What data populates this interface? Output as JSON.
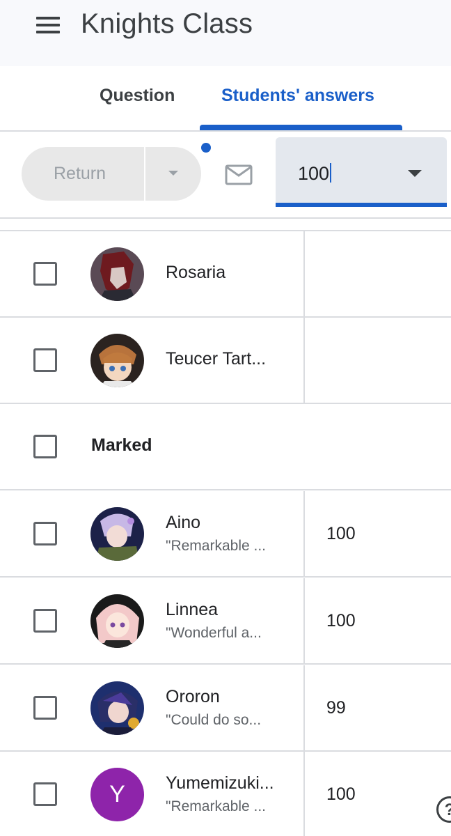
{
  "header": {
    "title": "Knights Class"
  },
  "tabs": [
    {
      "label": "Question",
      "selected": false
    },
    {
      "label": "Students' answers",
      "selected": true
    }
  ],
  "toolbar": {
    "return_label": "Return",
    "grade_value": "100"
  },
  "students_unmarked": [
    {
      "name": "Rosaria",
      "comment": "",
      "grade": ""
    },
    {
      "name": "Teucer Tart...",
      "comment": "",
      "grade": ""
    }
  ],
  "section": {
    "label": "Marked"
  },
  "students_marked": [
    {
      "name": "Aino",
      "comment": "\"Remarkable ...",
      "grade": "100"
    },
    {
      "name": "Linnea",
      "comment": "\"Wonderful a...",
      "grade": "100"
    },
    {
      "name": "Ororon",
      "comment": "\"Could do so...",
      "grade": "99"
    },
    {
      "name": "Yumemizuki...",
      "comment": "\"Remarkable ...",
      "grade": "100",
      "avatar_initial": "Y"
    }
  ],
  "help": {
    "glyph": "?"
  },
  "colors": {
    "accent": "#1a5fc9",
    "initial_avatar": "#8e24aa"
  }
}
